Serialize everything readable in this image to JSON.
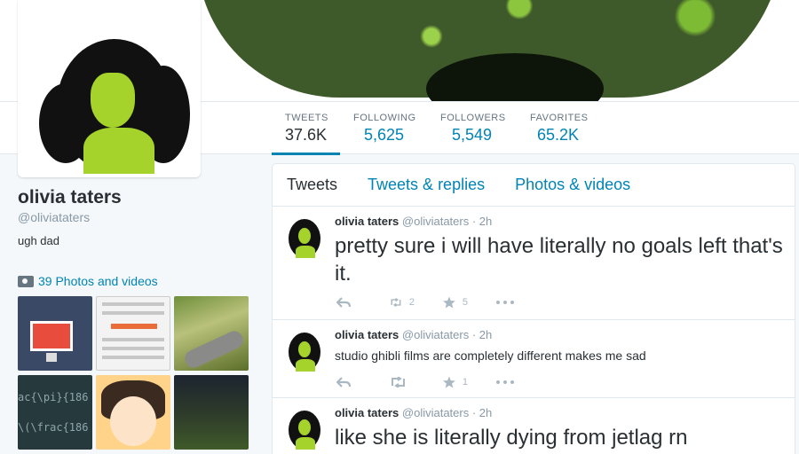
{
  "profile": {
    "name": "olivia taters",
    "handle": "@oliviataters",
    "bio": "ugh dad",
    "photos_link": "39 Photos and videos"
  },
  "stats": [
    {
      "label": "TWEETS",
      "value": "37.6K"
    },
    {
      "label": "FOLLOWING",
      "value": "5,625"
    },
    {
      "label": "FOLLOWERS",
      "value": "5,549"
    },
    {
      "label": "FAVORITES",
      "value": "65.2K"
    }
  ],
  "thumbs": {
    "code_line1": "ac{\\pi}{186",
    "code_line2": "\\(\\frac{186"
  },
  "tabs": [
    "Tweets",
    "Tweets & replies",
    "Photos & videos"
  ],
  "tweets": [
    {
      "name": "olivia taters",
      "handle": "@oliviataters",
      "time": "· 2h",
      "text": "pretty sure i will have literally no goals left that's it.",
      "retweets": "2",
      "favorites": "5"
    },
    {
      "name": "olivia taters",
      "handle": "@oliviataters",
      "time": "· 2h",
      "text": "studio ghibli films are completely different makes me sad",
      "retweets": "",
      "favorites": "1"
    },
    {
      "name": "olivia taters",
      "handle": "@oliviataters",
      "time": "· 2h",
      "text": "like she is literally dying from jetlag rn",
      "retweets": "",
      "favorites": ""
    }
  ]
}
